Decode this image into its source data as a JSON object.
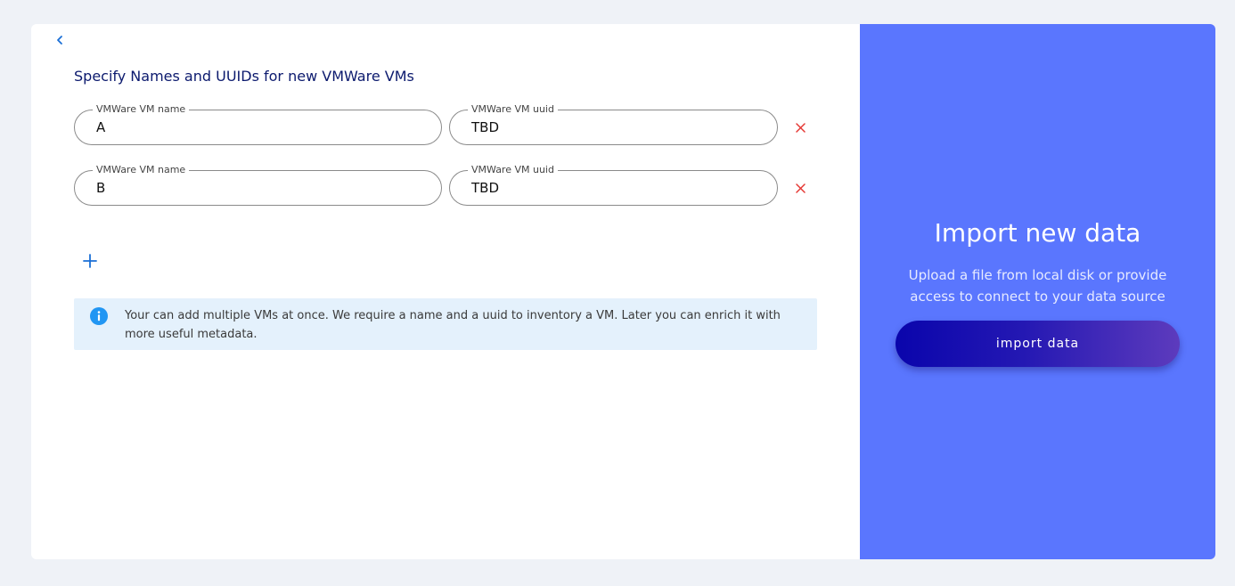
{
  "form": {
    "title": "Specify Names and UUIDs for new VMWare VMs",
    "rows": [
      {
        "name_label": "VMWare VM name",
        "name_value": "A",
        "uuid_label": "VMWare VM uuid",
        "uuid_value": "TBD"
      },
      {
        "name_label": "VMWare VM name",
        "name_value": "B",
        "uuid_label": "VMWare VM uuid",
        "uuid_value": "TBD"
      }
    ],
    "info_text": "Your can add multiple VMs at once. We require a name and a uuid to inventory a VM. Later you can enrich it with more useful metadata."
  },
  "icons": {
    "back": "chevron-left-icon",
    "remove": "close-icon",
    "add": "plus-icon",
    "info": "info-icon"
  },
  "sidebar": {
    "title": "Import new data",
    "subtitle": "Upload a file from local disk or provide access to connect to your data source",
    "button_label": "import data"
  },
  "colors": {
    "page_background": "#eff2f7",
    "panel_background": "#5a76fe",
    "accent_blue": "#1a6fd6",
    "remove_red": "#e53935",
    "info_background": "#e4f1fc",
    "info_icon": "#2196f3",
    "title_color": "#0c1a6e"
  }
}
